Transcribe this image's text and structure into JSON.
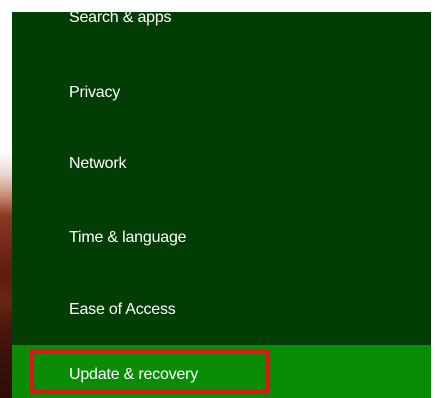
{
  "settings_menu": {
    "items": [
      {
        "label": "Search & apps"
      },
      {
        "label": "Privacy"
      },
      {
        "label": "Network"
      },
      {
        "label": "Time & language"
      },
      {
        "label": "Ease of Access"
      },
      {
        "label": "Update & recovery"
      }
    ],
    "selected_index": 5
  },
  "colors": {
    "pane_background": "#033d06",
    "selected_background": "#0a8c06",
    "highlight_border": "#e3121b",
    "text": "#ffffff"
  }
}
